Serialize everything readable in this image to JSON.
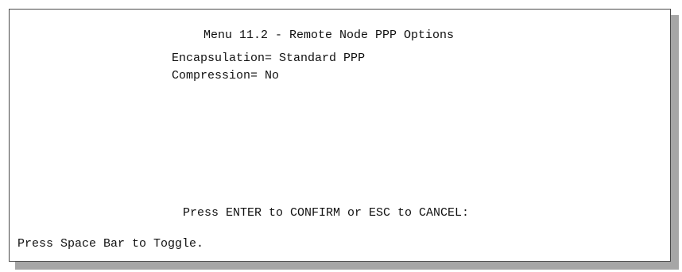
{
  "menu": {
    "title": "Menu 11.2 - Remote Node PPP Options"
  },
  "fields": [
    {
      "label": "Encapsulation=",
      "value": "Standard PPP"
    },
    {
      "label": "Compression=",
      "value": "No"
    }
  ],
  "prompt": "Press ENTER to CONFIRM or ESC to CANCEL:",
  "help": "Press Space Bar to Toggle."
}
